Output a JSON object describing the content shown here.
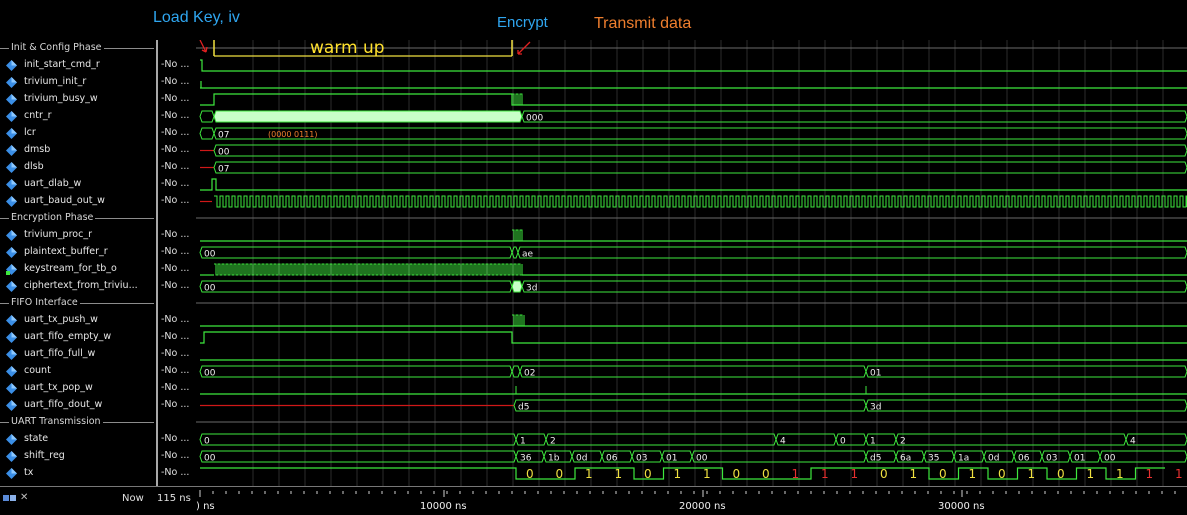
{
  "annotations": {
    "load_key": {
      "text": "Load Key, iv",
      "color": "#2fa6f0"
    },
    "encrypt": {
      "text": "Encrypt",
      "color": "#2fa6f0"
    },
    "transmit": {
      "text": "Transmit data",
      "color": "#f07f2e"
    },
    "warm_up": {
      "text": "warm up",
      "color": "#ffe12e"
    }
  },
  "groups": [
    {
      "label": "Init & Config Phase"
    },
    {
      "label": "Encryption Phase"
    },
    {
      "label": "FIFO Interface"
    },
    {
      "label": "UART Transmission"
    }
  ],
  "signals": [
    {
      "name": "init_start_cmd_r",
      "value": "-No ..."
    },
    {
      "name": "trivium_init_r",
      "value": "-No ..."
    },
    {
      "name": "trivium_busy_w",
      "value": "-No ..."
    },
    {
      "name": "cntr_r",
      "value": "-No ..."
    },
    {
      "name": "lcr",
      "value": "-No ..."
    },
    {
      "name": "dmsb",
      "value": "-No ..."
    },
    {
      "name": "dlsb",
      "value": "-No ..."
    },
    {
      "name": "uart_dlab_w",
      "value": "-No ..."
    },
    {
      "name": "uart_baud_out_w",
      "value": "-No ..."
    },
    {
      "name": "trivium_proc_r",
      "value": "-No ..."
    },
    {
      "name": "plaintext_buffer_r",
      "value": "-No ..."
    },
    {
      "name": "keystream_for_tb_o",
      "value": "-No ..."
    },
    {
      "name": "ciphertext_from_triviu...",
      "value": "-No ..."
    },
    {
      "name": "uart_tx_push_w",
      "value": "-No ..."
    },
    {
      "name": "uart_fifo_empty_w",
      "value": "-No ..."
    },
    {
      "name": "uart_fifo_full_w",
      "value": "-No ..."
    },
    {
      "name": "count",
      "value": "-No ..."
    },
    {
      "name": "uart_tx_pop_w",
      "value": "-No ..."
    },
    {
      "name": "uart_fifo_dout_w",
      "value": "-No ..."
    },
    {
      "name": "state",
      "value": "-No ..."
    },
    {
      "name": "shift_reg",
      "value": "-No ..."
    },
    {
      "name": "tx",
      "value": "-No ..."
    }
  ],
  "bus_labels": {
    "cntr_r": [
      "000"
    ],
    "lcr": [
      "07",
      "(0000 0111)"
    ],
    "dmsb": [
      "00"
    ],
    "dlsb": [
      "07"
    ],
    "plaintext_buffer_r": [
      "00",
      "ae"
    ],
    "ciphertext": [
      "00",
      "3d"
    ],
    "count": [
      "00",
      "02",
      "01"
    ],
    "uart_fifo_dout_w": [
      "d5",
      "3d"
    ],
    "state": [
      "0",
      "1",
      "2",
      "4",
      "0",
      "1",
      "2",
      "4"
    ],
    "shift_reg": [
      "00",
      "36",
      "1b",
      "0d",
      "06",
      "03",
      "01",
      "00",
      "d5",
      "6a",
      "35",
      "1a",
      "0d",
      "06",
      "03",
      "01",
      "00"
    ],
    "tx_bits": [
      "0",
      "0",
      "1",
      "1",
      "0",
      "1",
      "1",
      "0",
      "0",
      "1",
      "1",
      "1",
      "0",
      "1",
      "0",
      "1",
      "0",
      "1",
      "0",
      "1",
      "1",
      "1",
      "1"
    ]
  },
  "status": {
    "now_label": "Now",
    "now_value": "115 ns"
  },
  "timeline": {
    "ticks": [
      ") ns",
      "10000 ns",
      "20000 ns",
      "30000 ns"
    ]
  },
  "colors": {
    "wave": "#3ee83e",
    "bus_fill": "#c8ffc8",
    "red_line": "#d01818",
    "tx_red": "#e83030",
    "tx_yellow": "#f0e040",
    "cursor": "#f0e040",
    "grid": "#3a3a3a"
  }
}
